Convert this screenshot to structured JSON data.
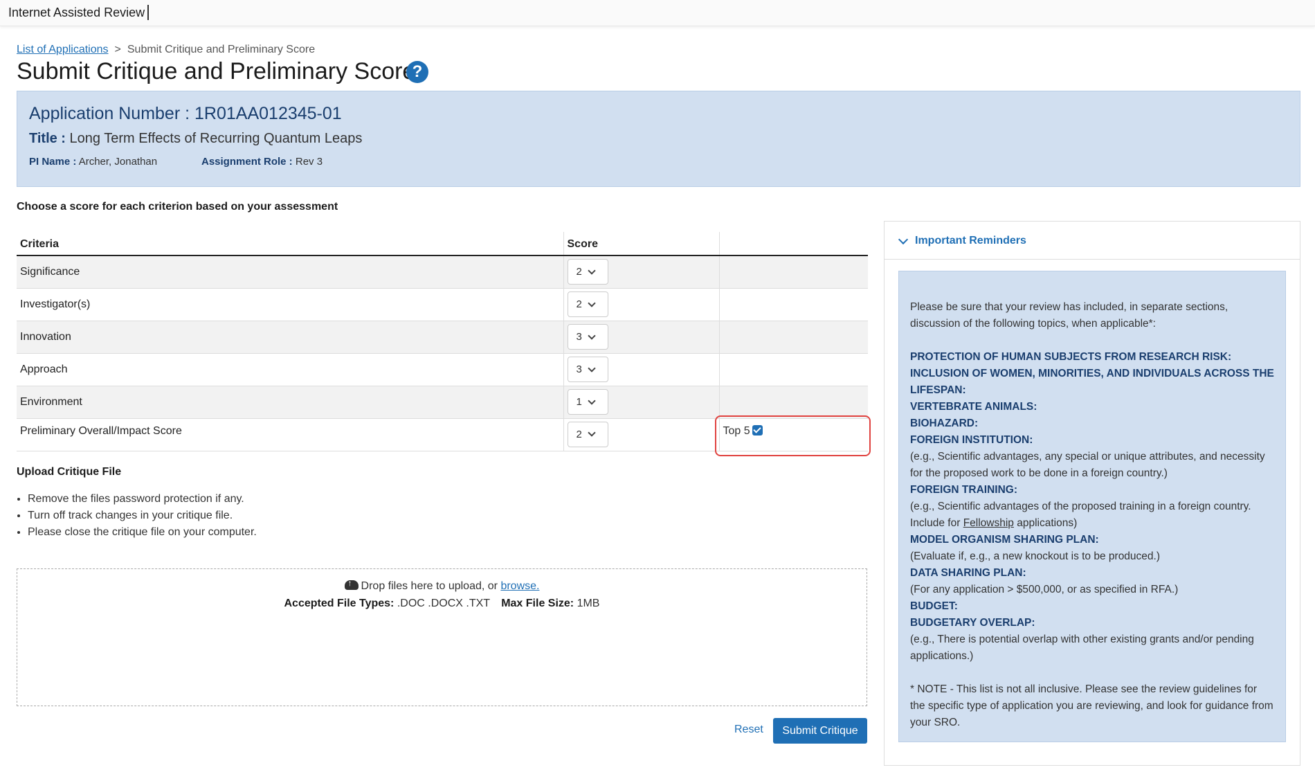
{
  "header": {
    "app_title": "Internet Assisted Review"
  },
  "breadcrumb": {
    "link": "List of Applications",
    "separator": ">",
    "current": "Submit Critique and Preliminary Score"
  },
  "page": {
    "title": "Submit Critique and Preliminary Score",
    "help_glyph": "?"
  },
  "application": {
    "number_label": "Application Number :",
    "number_value": "1R01AA012345-01",
    "title_label": "Title :",
    "title_value": "Long Term Effects of Recurring Quantum Leaps",
    "pi_label": "PI Name :",
    "pi_value": "Archer, Jonathan",
    "role_label": "Assignment Role :",
    "role_value": "Rev 3"
  },
  "instruction": "Choose a score for each criterion based on your assessment",
  "table": {
    "headers": [
      "Criteria",
      "Score",
      ""
    ],
    "rows": [
      {
        "criterion": "Significance",
        "score": "2"
      },
      {
        "criterion": "Investigator(s)",
        "score": "2"
      },
      {
        "criterion": "Innovation",
        "score": "3"
      },
      {
        "criterion": "Approach",
        "score": "3"
      },
      {
        "criterion": "Environment",
        "score": "1"
      },
      {
        "criterion": "Preliminary Overall/Impact Score",
        "score": "2",
        "extra_label": "Top 5",
        "extra_checked": true
      }
    ]
  },
  "upload": {
    "title": "Upload Critique File",
    "tips": [
      "Remove the files password protection if any.",
      "Turn off track changes in your critique file.",
      "Please close the critique file on your computer."
    ],
    "drop_text": "Drop files here to upload, or",
    "browse_link": "browse.",
    "types_label": "Accepted File Types:",
    "types_value": ".DOC .DOCX .TXT",
    "size_label": "Max File Size:",
    "size_value": "1MB"
  },
  "actions": {
    "reset": "Reset",
    "submit": "Submit Critique"
  },
  "reminders": {
    "title": "Important Reminders",
    "intro": "Please be sure that your review has included, in separate sections, discussion of the following topics, when applicable*:",
    "h1": "PROTECTION OF HUMAN SUBJECTS FROM RESEARCH RISK:",
    "h2": "INCLUSION OF WOMEN, MINORITIES, AND INDIVIDUALS ACROSS THE LIFESPAN:",
    "h3": "VERTEBRATE ANIMALS:",
    "h4": "BIOHAZARD:",
    "h5": "FOREIGN INSTITUTION:",
    "t5": "(e.g., Scientific advantages, any special or unique attributes, and necessity for the proposed work to be done in a foreign country.)",
    "h6": "FOREIGN TRAINING:",
    "t6a": "(e.g., Scientific advantages of the proposed training in a foreign country. Include for",
    "t6link": "Fellowship",
    "t6b": "applications)",
    "h7": "MODEL ORGANISM SHARING PLAN:",
    "t7": "(Evaluate if, e.g., a new knockout is to be produced.)",
    "h8": "DATA SHARING PLAN:",
    "t8": "(For any application > $500,000, or as specified in RFA.)",
    "h9": "BUDGET:",
    "h10": "BUDGETARY OVERLAP:",
    "t10": "(e.g., There is potential overlap with other existing grants and/or pending applications.)",
    "note": "* NOTE - This list is not all inclusive. Please see the review guidelines for the specific type of application you are reviewing, and look for guidance from your SRO."
  }
}
